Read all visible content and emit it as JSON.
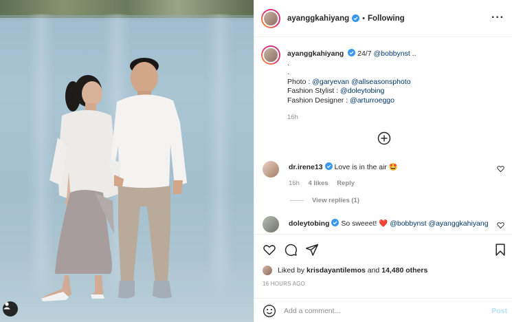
{
  "post": {
    "username": "ayanggkahiyang",
    "follow_status": "Following",
    "more_icon": "more-options-icon",
    "caption": {
      "username": "ayanggkahiyang",
      "line1": "24/7 ",
      "mention1": "@bobbynst",
      "line1_end": " ..",
      "dot1": ".",
      "dot2": ".",
      "photo_label": "Photo : ",
      "photo_m1": "@garyevan",
      "photo_m2": "@allseasonsphoto",
      "stylist_label": "Fashion Stylist : ",
      "stylist_m": "@doleytobing",
      "designer_label": "Fashion Designer : ",
      "designer_m": "@arturroeggo",
      "time": "16h"
    },
    "comments": [
      {
        "username": "dr.irene13",
        "text": "Love is in the air",
        "emoji": "🤩",
        "time": "16h",
        "likes": "4 likes",
        "reply": "Reply",
        "view_replies": "View replies (1)"
      },
      {
        "username": "doleytobing",
        "text": "So sweeet!",
        "emoji": "❤️",
        "mention1": "@bobbynst",
        "mention2": "@ayanggkahiyang"
      }
    ],
    "liked_by_prefix": "Liked by ",
    "liked_by_user": "krisdayantilemos",
    "liked_by_and": " and ",
    "liked_by_others": "14,480 others",
    "posted_ago": "16 HOURS AGO",
    "comment_placeholder": "Add a comment...",
    "post_label": "Post",
    "colors": {
      "link": "#00376b",
      "verified": "#3897f0",
      "post_disabled": "#b2dffc",
      "muted": "#8e8e8e"
    }
  }
}
